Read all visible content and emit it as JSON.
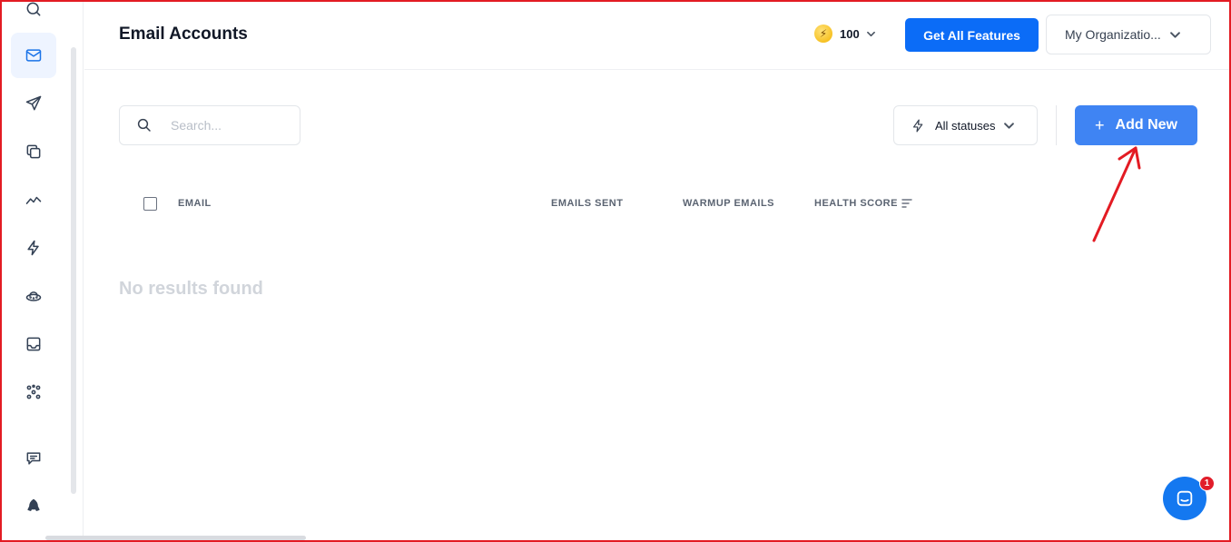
{
  "header": {
    "title": "Email Accounts",
    "credits": "100",
    "features_button": "Get All Features",
    "organization": "My Organizatio..."
  },
  "toolbar": {
    "search_placeholder": "Search...",
    "status_filter": "All statuses",
    "add_button": "Add New",
    "add_button_icon": "+"
  },
  "table": {
    "columns": [
      "EMAIL",
      "EMAILS SENT",
      "WARMUP EMAILS",
      "HEALTH SCORE"
    ],
    "empty_message": "No results found"
  },
  "sidebar": {
    "items": [
      {
        "icon": "search-icon"
      },
      {
        "icon": "mail-icon",
        "active": true
      },
      {
        "icon": "send-icon"
      },
      {
        "icon": "copy-icon"
      },
      {
        "icon": "analytics-icon"
      },
      {
        "icon": "bolt-icon"
      },
      {
        "icon": "ufo-icon"
      },
      {
        "icon": "inbox-icon"
      },
      {
        "icon": "integrations-icon"
      },
      {
        "icon": "feedback-icon"
      },
      {
        "icon": "rocket-icon"
      }
    ]
  },
  "chat": {
    "badge_count": "1"
  },
  "colors": {
    "primary": "#0b6cf7",
    "add_button": "#3f84f3",
    "annotation": "#e31b23",
    "badge": "#e11d2a"
  }
}
